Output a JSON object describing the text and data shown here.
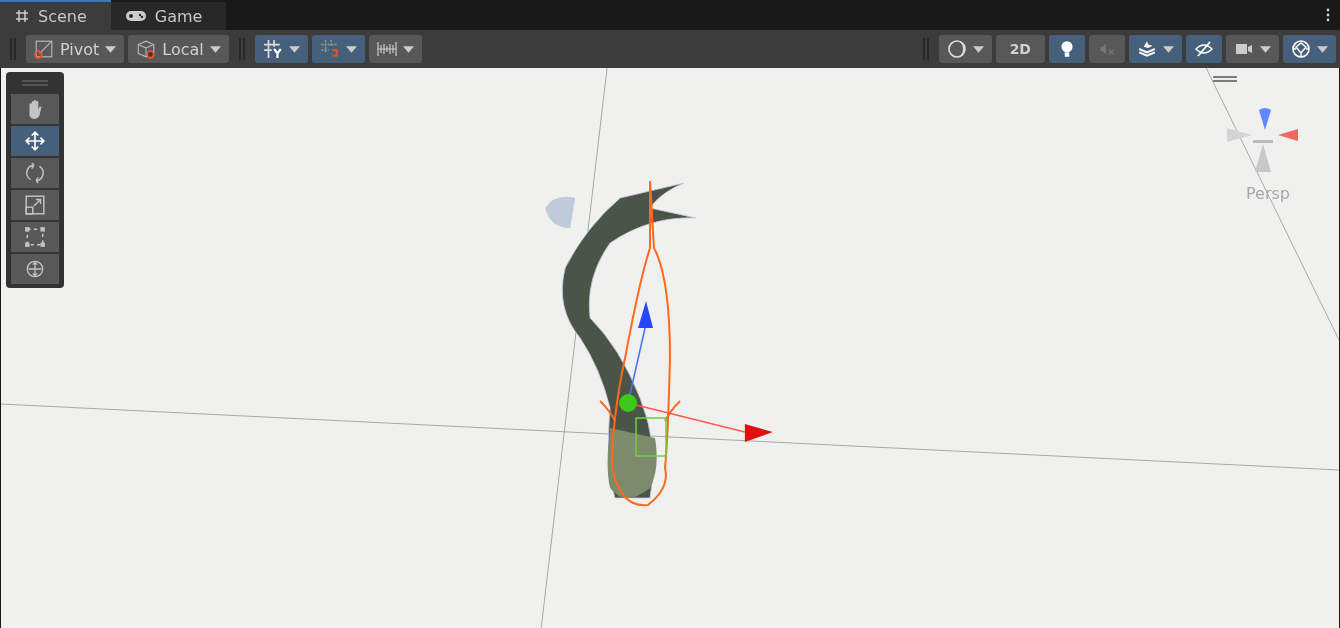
{
  "tabs": [
    {
      "label": "Scene",
      "kind": "scene",
      "selected": true
    },
    {
      "label": "Game",
      "kind": "game",
      "selected": false
    }
  ],
  "toolbar": {
    "left": [
      [
        {
          "kind": "pivot",
          "label": "Pivot",
          "caret": true,
          "on": false
        },
        {
          "kind": "local",
          "label": "Local",
          "caret": true,
          "on": false
        }
      ],
      [
        {
          "kind": "grid-snap",
          "caret": true,
          "on": true
        },
        {
          "kind": "increment-snap",
          "caret": true,
          "on": true
        },
        {
          "kind": "grid",
          "caret": true,
          "on": false
        }
      ]
    ],
    "right": [
      [
        {
          "kind": "shading",
          "caret": true,
          "on": false
        },
        {
          "kind": "text",
          "label": "2D",
          "caret": false,
          "on": false
        },
        {
          "kind": "lighting",
          "caret": false,
          "on": true
        },
        {
          "kind": "audio",
          "caret": false,
          "on": false
        },
        {
          "kind": "effects",
          "caret": true,
          "on": true
        },
        {
          "kind": "visibility",
          "caret": false,
          "on": true
        },
        {
          "kind": "camera",
          "caret": true,
          "on": false
        },
        {
          "kind": "gizmos",
          "caret": true,
          "on": true
        }
      ]
    ]
  },
  "tools": [
    {
      "kind": "hand",
      "selected": false
    },
    {
      "kind": "move",
      "selected": true
    },
    {
      "kind": "rotate",
      "selected": false
    },
    {
      "kind": "scale",
      "selected": false
    },
    {
      "kind": "rect",
      "selected": false
    },
    {
      "kind": "transform",
      "selected": false
    }
  ],
  "orientation_gizmo": {
    "label": "Persp"
  }
}
